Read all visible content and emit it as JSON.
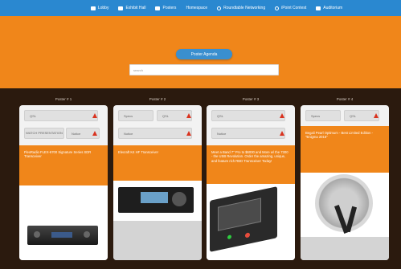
{
  "nav": {
    "items": [
      {
        "label": "Lobby",
        "icon": "door-icon"
      },
      {
        "label": "Exhibit Hall",
        "icon": "gallery-icon"
      },
      {
        "label": "Posters",
        "icon": "poster-icon"
      },
      {
        "label": "Homespace",
        "icon": "home-icon"
      },
      {
        "label": "Roundtable Networking",
        "icon": "people-icon"
      },
      {
        "label": "iPoint Contest",
        "icon": "target-icon"
      },
      {
        "label": "Auditorium",
        "icon": "screen-icon"
      }
    ]
  },
  "hero": {
    "button_label": "Poster Agenda",
    "search_placeholder": "search"
  },
  "columns": [
    {
      "label": "Poster # 1",
      "tags": [
        "QSL",
        "",
        "WATCH PRESENTATION",
        "Notice"
      ],
      "title": "FlexRadio FLEX-6700 Signature Series SDR Transceiver"
    },
    {
      "label": "Poster # 2",
      "tags": [
        "Specs",
        "QSL",
        "Notice"
      ],
      "title": "Elecraft K4 HF Transceiver"
    },
    {
      "label": "Poster # 3",
      "tags": [
        "QSL",
        "Notice"
      ],
      "title": "Meet a Band 7\" Pro to $6000 and More w/ the 7300 - the USB Revolution. Order the amazing, unique, and feature rich RBD Transceiver Today!"
    },
    {
      "label": "Poster # 4",
      "tags": [
        "Specs",
        "QSL"
      ],
      "title": "Begali Pearl Optimum - Best Limited Edition - \"Enigma 2016\""
    }
  ],
  "colors": {
    "nav": "#2a88d0",
    "hero": "#f0861a",
    "background": "#2b1a0e",
    "accent_button": "#3a8fcf",
    "delete_icon": "#d9331f"
  }
}
